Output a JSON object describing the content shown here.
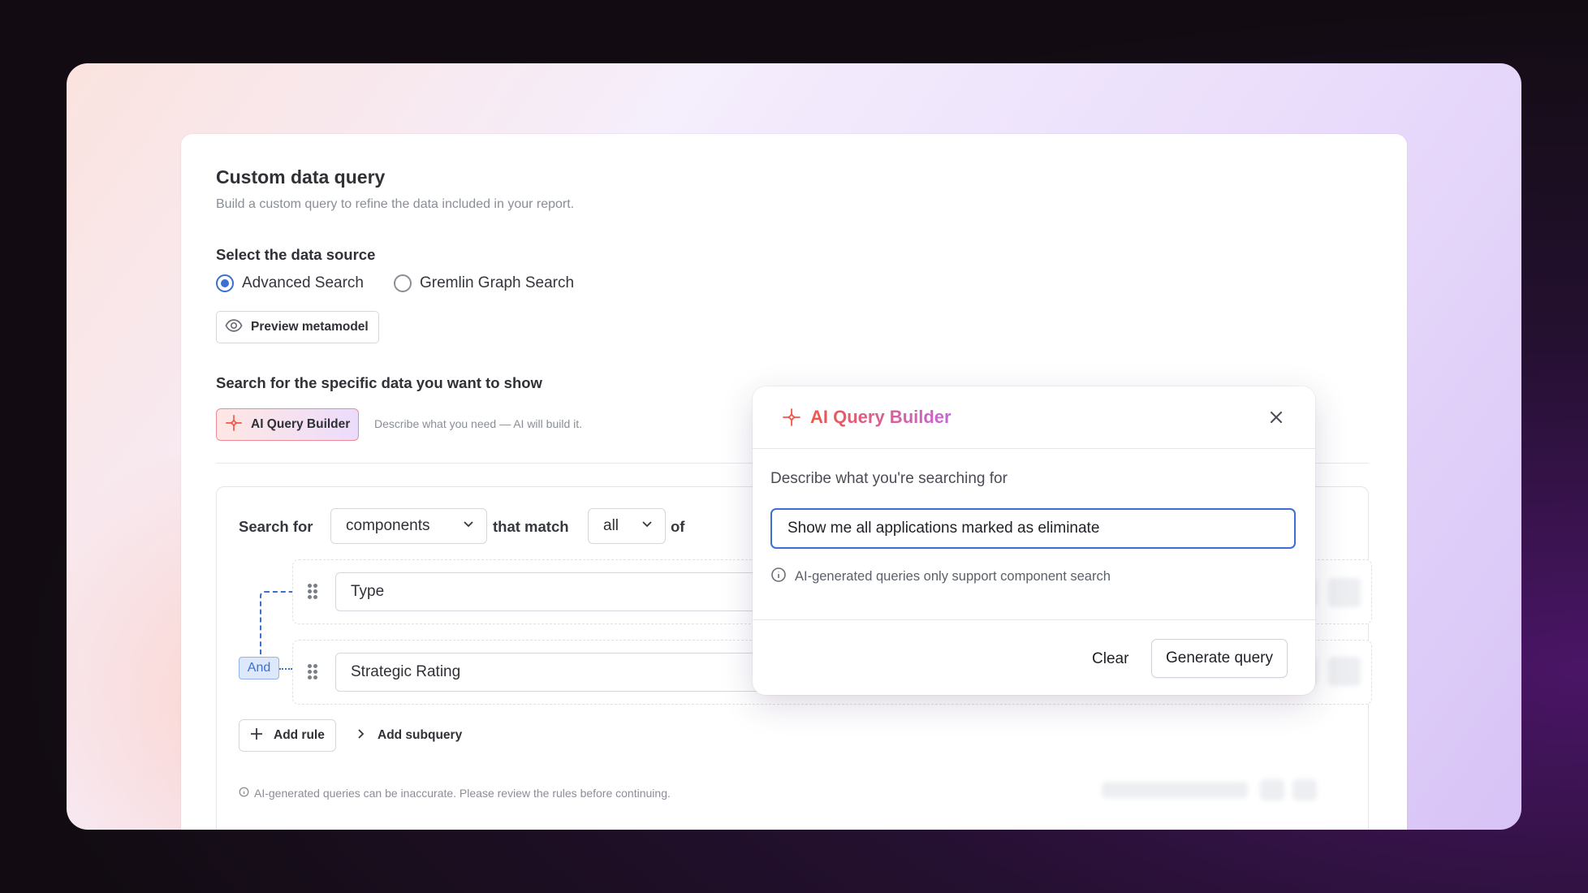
{
  "page": {
    "title": "Custom data query",
    "subtitle": "Build a custom query to refine the data included in your report."
  },
  "data_source": {
    "label": "Select the data source",
    "options": [
      "Advanced Search",
      "Gremlin Graph Search"
    ],
    "selected": "Advanced Search",
    "preview_button": "Preview metamodel"
  },
  "search_section": {
    "label": "Search for the specific data you want to show",
    "ai_button": "AI Query Builder",
    "ai_hint": "Describe what you need — AI will build it."
  },
  "builder": {
    "search_for_label": "Search for",
    "entity_value": "components",
    "that_match_label": "that match",
    "match_value": "all",
    "of_label": "of",
    "rules": [
      {
        "field": "Type"
      },
      {
        "field": "Strategic Rating"
      }
    ],
    "connector": "And",
    "add_rule": "Add rule",
    "add_subquery": "Add subquery",
    "footnote": "AI-generated queries can be inaccurate. Please review the rules before continuing."
  },
  "modal": {
    "title": "AI Query Builder",
    "prompt_label": "Describe what you're searching for",
    "input_value": "Show me all applications marked as eliminate",
    "info": "AI-generated queries only support component search",
    "clear": "Clear",
    "generate": "Generate query"
  },
  "colors": {
    "accent_blue": "#3b6fd0",
    "ai_gradient_start": "#f0564a",
    "ai_gradient_end": "#c467d8"
  }
}
